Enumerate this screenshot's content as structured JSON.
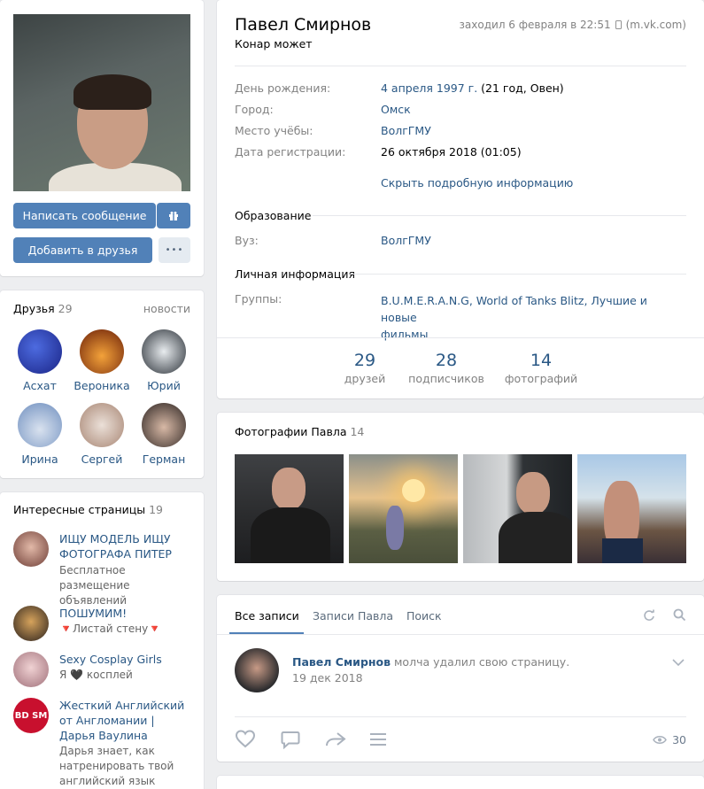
{
  "profile": {
    "name": "Павел Смирнов",
    "status": "Конар может",
    "last_seen": "заходил 6 февраля в 22:51",
    "last_seen_via": "(m.vk.com)",
    "rows": [
      {
        "label": "День рождения:",
        "value_link": "4 апреля 1997 г.",
        "value_rest": " (21 год, Овен)"
      },
      {
        "label": "Город:",
        "value_link": "Омск",
        "value_rest": ""
      },
      {
        "label": "Место учёбы:",
        "value_link": "ВолгГМУ",
        "value_rest": ""
      },
      {
        "label": "Дата регистрации:",
        "value_link": "",
        "value_rest": "26 октября 2018 (01:05)"
      }
    ],
    "hide_details": "Скрыть подробную информацию",
    "education_title": "Образование",
    "edu_label": "Вуз:",
    "edu_value": "ВолгГМУ",
    "personal_title": "Личная информация",
    "groups_label": "Группы:",
    "groups_line1": "B.U.M.E.R.A.N.G, World of Tanks Blitz, Лучшие и новые",
    "groups_line2": "фильмы",
    "counters": [
      {
        "num": "29",
        "label": "друзей"
      },
      {
        "num": "28",
        "label": "подписчиков"
      },
      {
        "num": "14",
        "label": "фотографий"
      }
    ]
  },
  "actions": {
    "message": "Написать сообщение",
    "add_friend": "Добавить в друзья",
    "more": "•••"
  },
  "friends": {
    "title": "Друзья",
    "count": "29",
    "news": "новости",
    "items": [
      {
        "name": "Асхат",
        "color": "#2b3fb8"
      },
      {
        "name": "Вероника",
        "color": "#b4531e"
      },
      {
        "name": "Юрий",
        "color": "#3a4450"
      },
      {
        "name": "Ирина",
        "color": "#6f8fbf"
      },
      {
        "name": "Сергей",
        "color": "#c7b1a4"
      },
      {
        "name": "Герман",
        "color": "#4a3c36"
      }
    ]
  },
  "pages": {
    "title": "Интересные страницы",
    "count": "19",
    "items": [
      {
        "title": "ИЩУ МОДЕЛЬ ИЩУ ФОТОГРАФА ПИТЕР",
        "sub": "Бесплатное размещение объявлений",
        "color": "#8c5a52"
      },
      {
        "title": "ПОШУМИМ!",
        "sub": "🔻Листай стену🔻",
        "color": "#3b2f2a"
      },
      {
        "title": "Sexy Cosplay Girls",
        "sub": "Я 🖤 косплей",
        "color": "#b78c8f"
      },
      {
        "title": "Жесткий Английский от Англомании | Дарья Ваулина",
        "sub": "Дарья знает, как натренировать твой английский язык",
        "color": "#c8102e",
        "badge": "BD SM"
      }
    ]
  },
  "photos": {
    "title": "Фотографии Павла",
    "count": "14"
  },
  "wall": {
    "tabs": [
      "Все записи",
      "Записи Павла",
      "Поиск"
    ],
    "post_author": "Павел Смирнов",
    "post_text": " молча удалил свою страницу.",
    "post_date": "19 дек 2018",
    "views": "30"
  }
}
